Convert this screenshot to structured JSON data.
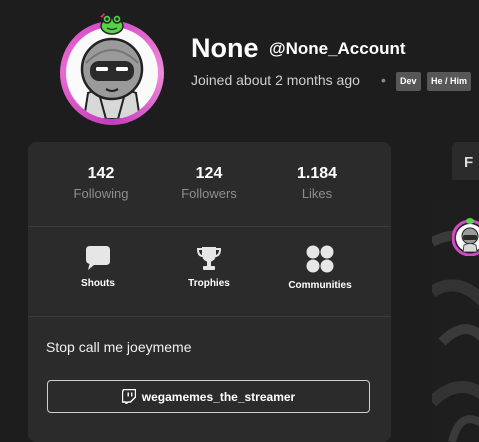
{
  "profile": {
    "display_name": "None",
    "handle": "@None_Account",
    "joined": "Joined about 2 months ago",
    "separator": "•",
    "badges": [
      "Dev",
      "He / Him"
    ]
  },
  "stats": [
    {
      "value": "142",
      "label": "Following"
    },
    {
      "value": "124",
      "label": "Followers"
    },
    {
      "value": "1.184",
      "label": "Likes"
    }
  ],
  "actions": [
    {
      "label": "Shouts",
      "icon": "speech-bubble-icon"
    },
    {
      "label": "Trophies",
      "icon": "trophy-icon"
    },
    {
      "label": "Communities",
      "icon": "communities-icon"
    }
  ],
  "bio": "Stop call me joeymeme",
  "twitch": {
    "label": "wegamemes_the_streamer",
    "icon": "twitch-icon"
  },
  "tab": {
    "label": "F"
  },
  "colors": {
    "background": "#1d1d1d",
    "card": "#2b2b2b",
    "avatar_ring": "#d14ac7",
    "badge": "#575757"
  }
}
